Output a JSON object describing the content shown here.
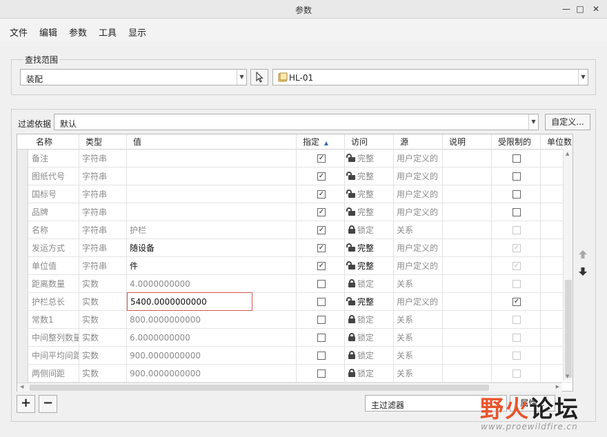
{
  "window": {
    "title": "参数",
    "min": "—",
    "max": "□",
    "close": "✕"
  },
  "menu": [
    "文件",
    "编辑",
    "参数",
    "工具",
    "显示"
  ],
  "scope": {
    "group_title": "查找范围",
    "type_value": "装配",
    "model_value": "HL-01"
  },
  "filter": {
    "label": "过滤依据",
    "value": "默认",
    "customize_label": "自定义..."
  },
  "table": {
    "columns": [
      "名称",
      "类型",
      "值",
      "指定",
      "访问",
      "源",
      "说明",
      "受限制的",
      "单位数"
    ],
    "sort_indicator": "▲",
    "rows": [
      {
        "name": "备注",
        "type": "字符串",
        "value": "",
        "designated": true,
        "access": "完整",
        "locked": false,
        "source": "用户定义的",
        "restricted": false,
        "restricted_disabled": false,
        "dark": false
      },
      {
        "name": "图纸代号",
        "type": "字符串",
        "value": "",
        "designated": true,
        "access": "完整",
        "locked": false,
        "source": "用户定义的",
        "restricted": false,
        "restricted_disabled": false,
        "dark": false
      },
      {
        "name": "国标号",
        "type": "字符串",
        "value": "",
        "designated": true,
        "access": "完整",
        "locked": false,
        "source": "用户定义的",
        "restricted": false,
        "restricted_disabled": false,
        "dark": false
      },
      {
        "name": "品牌",
        "type": "字符串",
        "value": "",
        "designated": true,
        "access": "完整",
        "locked": false,
        "source": "用户定义的",
        "restricted": false,
        "restricted_disabled": false,
        "dark": false
      },
      {
        "name": "名称",
        "type": "字符串",
        "value": "护栏",
        "designated": true,
        "access": "锁定",
        "locked": true,
        "source": "关系",
        "restricted": false,
        "restricted_disabled": true,
        "dark": false
      },
      {
        "name": "发运方式",
        "type": "字符串",
        "value": "随设备",
        "designated": true,
        "access": "完整",
        "locked": false,
        "source": "用户定义的",
        "restricted": true,
        "restricted_disabled": true,
        "dark": true
      },
      {
        "name": "单位值",
        "type": "字符串",
        "value": "件",
        "designated": true,
        "access": "完整",
        "locked": false,
        "source": "用户定义的",
        "restricted": true,
        "restricted_disabled": true,
        "dark": true
      },
      {
        "name": "距离数量",
        "type": "实数",
        "value": "4.0000000000",
        "designated": false,
        "access": "锁定",
        "locked": true,
        "source": "关系",
        "restricted": false,
        "restricted_disabled": true,
        "dark": false
      },
      {
        "name": "护栏总长",
        "type": "实数",
        "value": "5400.0000000000",
        "designated": false,
        "access": "完整",
        "locked": false,
        "source": "用户定义的",
        "restricted": true,
        "restricted_disabled": false,
        "dark": true,
        "editing": true
      },
      {
        "name": "常数1",
        "type": "实数",
        "value": "800.0000000000",
        "designated": false,
        "access": "锁定",
        "locked": true,
        "source": "关系",
        "restricted": false,
        "restricted_disabled": true,
        "dark": false
      },
      {
        "name": "中间整列数量",
        "type": "实数",
        "value": "6.0000000000",
        "designated": false,
        "access": "锁定",
        "locked": true,
        "source": "关系",
        "restricted": false,
        "restricted_disabled": true,
        "dark": false
      },
      {
        "name": "中间平均间距",
        "type": "实数",
        "value": "900.0000000000",
        "designated": false,
        "access": "锁定",
        "locked": true,
        "source": "关系",
        "restricted": false,
        "restricted_disabled": true,
        "dark": false
      },
      {
        "name": "两侧间距",
        "type": "实数",
        "value": "900.0000000000",
        "designated": false,
        "access": "锁定",
        "locked": true,
        "source": "关系",
        "restricted": false,
        "restricted_disabled": true,
        "dark": false
      }
    ]
  },
  "bottom": {
    "add_label": "+",
    "remove_label": "−",
    "main_filter_label": "主过滤器",
    "property_label": "属性..."
  },
  "watermark": {
    "logo_a": "野火",
    "logo_b": "论坛",
    "url": "www.proewildfire.cn"
  },
  "colors": {
    "accent_red": "#d9534f",
    "logo_orange": "#e8552d"
  },
  "icons": {
    "select": "cursor-arrow-icon",
    "model": "assembly-cube-icon",
    "move_up": "arrow-up-icon",
    "move_down": "arrow-down-icon",
    "lock": "lock-icon",
    "unlock": "unlock-icon"
  }
}
